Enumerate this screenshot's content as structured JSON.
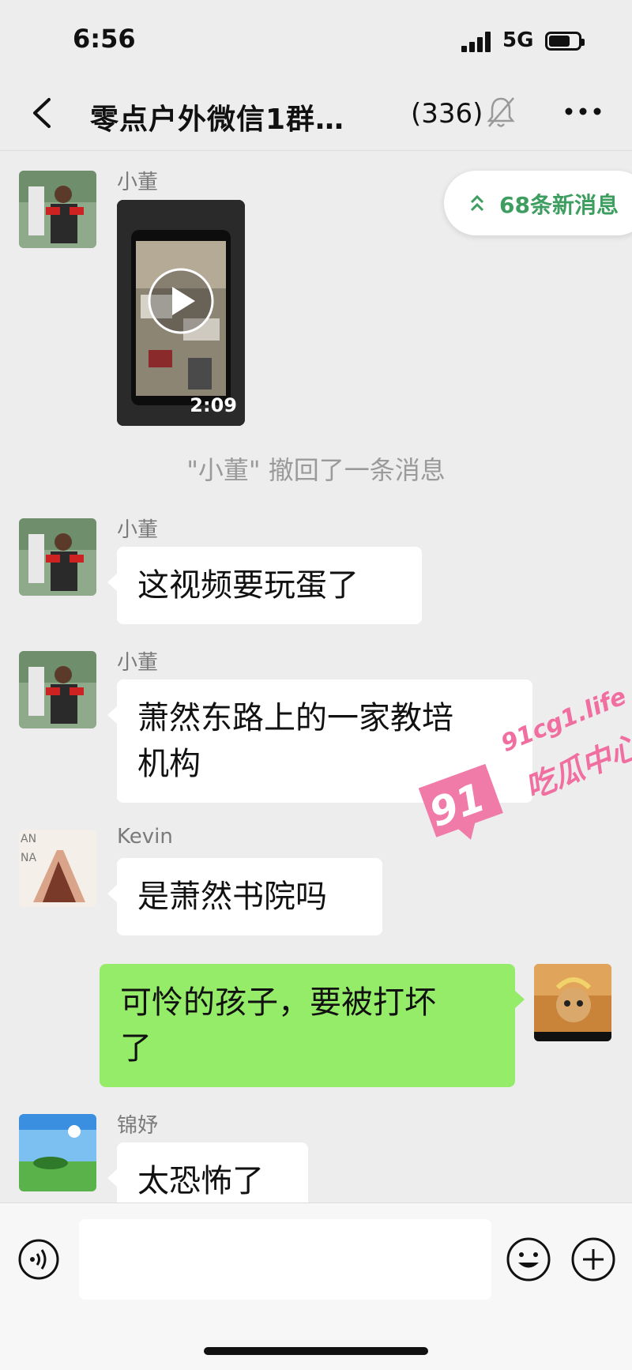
{
  "status": {
    "time": "6:56",
    "network": "5G"
  },
  "nav": {
    "title": "零点户外微信1群…",
    "member_count": "(336)"
  },
  "new_messages": {
    "label": "68条新消息"
  },
  "messages": [
    {
      "sender": "小董",
      "type": "video",
      "duration": "2:09"
    },
    {
      "sender": "小董",
      "text": "这视频要玩蛋了"
    },
    {
      "sender": "小董",
      "text_line1": "萧然东路上的一家教培",
      "text_line2": "机构"
    },
    {
      "sender": "Kevin",
      "text": "是萧然书院吗"
    },
    {
      "sender": "me",
      "text_line1": "可怜的孩子，要被打坏",
      "text_line2": "了"
    },
    {
      "sender": "锦妤",
      "text": "太恐怖了"
    }
  ],
  "system": {
    "recall_notice": "\"小董\" 撤回了一条消息"
  },
  "watermark": {
    "domain": "91cg1.life",
    "name": "吃瓜中心",
    "badge": "91"
  },
  "colors": {
    "my_bubble": "#95ec69",
    "accent_green": "#3d9e5f",
    "background": "#ededed"
  }
}
